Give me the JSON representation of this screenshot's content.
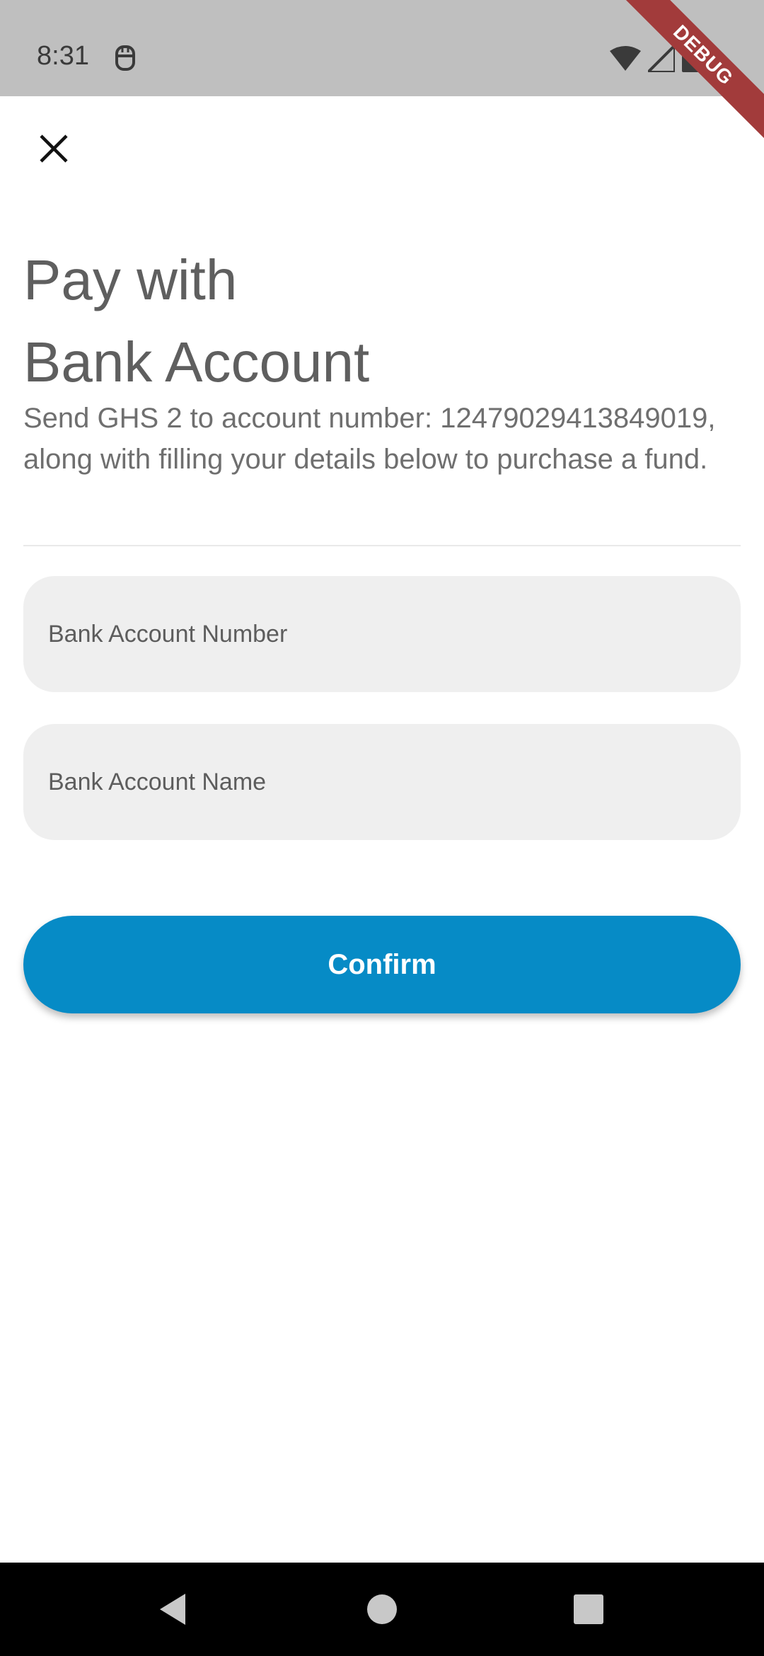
{
  "status_bar": {
    "time": "8:31",
    "debug_label": "DEBUG",
    "icons": [
      "app-notification-icon",
      "wifi-icon",
      "cell-signal-icon",
      "battery-icon"
    ]
  },
  "header": {
    "close_icon": "close-icon"
  },
  "title": {
    "line1": "Pay with",
    "line2": "Bank Account"
  },
  "description": "Send GHS 2 to account number: 12479029413849019, along with filling your details below to purchase a fund.",
  "form": {
    "account_number_placeholder": "Bank Account Number",
    "account_name_placeholder": "Bank Account Name",
    "confirm_label": "Confirm"
  },
  "nav_bar": {
    "icons": [
      "back-icon",
      "home-icon",
      "recents-icon"
    ]
  },
  "colors": {
    "accent": "#068bc6",
    "status_bar": "#bfbfbf",
    "field_bg": "#efefef",
    "debug": "#a23b3b"
  }
}
